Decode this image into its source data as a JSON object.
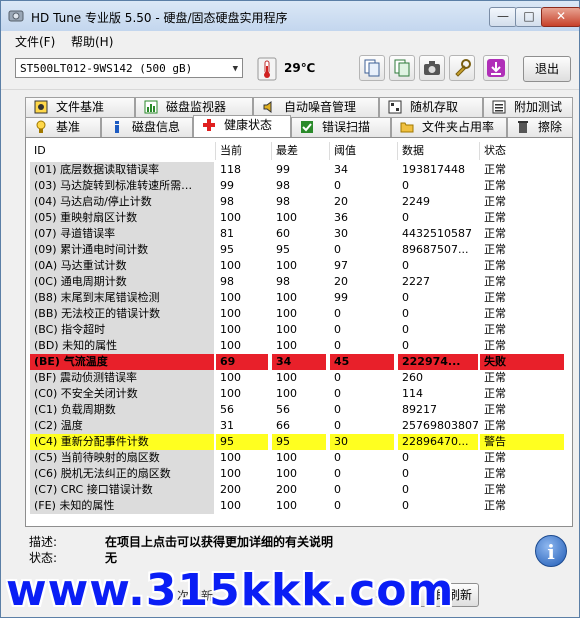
{
  "window": {
    "title": "HD Tune 专业版 5.50 - 硬盘/固态硬盘实用程序"
  },
  "menu": {
    "file": "文件(F)",
    "help": "帮助(H)"
  },
  "toolbar": {
    "drive": "ST500LT012-9WS142 (500 gB)",
    "temperature": "29℃",
    "exit_label": "退出",
    "icons": [
      "copy-info-icon",
      "copy-report-icon",
      "screenshot-camera-icon",
      "options-wrench-icon",
      "save-download-icon"
    ]
  },
  "tabs_top": [
    {
      "label": "文件基准",
      "icon": "file-benchmark-icon"
    },
    {
      "label": "磁盘监视器",
      "icon": "disk-monitor-icon"
    },
    {
      "label": "自动噪音管理",
      "icon": "speaker-icon"
    },
    {
      "label": "随机存取",
      "icon": "random-access-icon"
    },
    {
      "label": "附加测试",
      "icon": "extra-tests-icon"
    }
  ],
  "tabs_bottom": [
    {
      "label": "基准",
      "icon": "benchmark-icon"
    },
    {
      "label": "磁盘信息",
      "icon": "info-icon"
    },
    {
      "label": "健康状态",
      "icon": "health-cross-icon",
      "active": true
    },
    {
      "label": "错误扫描",
      "icon": "error-scan-icon"
    },
    {
      "label": "文件夹占用率",
      "icon": "folder-icon"
    },
    {
      "label": "擦除",
      "icon": "erase-bin-icon"
    }
  ],
  "table": {
    "headers": [
      "ID",
      "当前",
      "最差",
      "阈值",
      "数据",
      "状态"
    ],
    "rows": [
      [
        "(01) 底层数据读取错误率",
        "118",
        "99",
        "34",
        "193817448",
        "正常"
      ],
      [
        "(03) 马达旋转到标准转速所需…",
        "99",
        "98",
        "0",
        "0",
        "正常"
      ],
      [
        "(04) 马达启动/停止计数",
        "98",
        "98",
        "20",
        "2249",
        "正常"
      ],
      [
        "(05) 重映射扇区计数",
        "100",
        "100",
        "36",
        "0",
        "正常"
      ],
      [
        "(07) 寻道错误率",
        "81",
        "60",
        "30",
        "4432510587",
        "正常"
      ],
      [
        "(09) 累计通电时间计数",
        "95",
        "95",
        "0",
        "89687507...",
        "正常"
      ],
      [
        "(0A) 马达重试计数",
        "100",
        "100",
        "97",
        "0",
        "正常"
      ],
      [
        "(0C) 通电周期计数",
        "98",
        "98",
        "20",
        "2227",
        "正常"
      ],
      [
        "(B8) 末尾到末尾错误检测",
        "100",
        "100",
        "99",
        "0",
        "正常"
      ],
      [
        "(BB) 无法校正的错误计数",
        "100",
        "100",
        "0",
        "0",
        "正常"
      ],
      [
        "(BC) 指令超时",
        "100",
        "100",
        "0",
        "0",
        "正常"
      ],
      [
        "(BD) 未知的属性",
        "100",
        "100",
        "0",
        "0",
        "正常"
      ],
      [
        "(BE) 气流温度",
        "69",
        "34",
        "45",
        "222974...",
        "失败"
      ],
      [
        "(BF) 震动侦测错误率",
        "100",
        "100",
        "0",
        "260",
        "正常"
      ],
      [
        "(C0) 不安全关闭计数",
        "100",
        "100",
        "0",
        "114",
        "正常"
      ],
      [
        "(C1) 负载周期数",
        "56",
        "56",
        "0",
        "89217",
        "正常"
      ],
      [
        "(C2) 温度",
        "31",
        "66",
        "0",
        "25769803807",
        "正常"
      ],
      [
        "(C4) 重新分配事件计数",
        "95",
        "95",
        "30",
        "22896470...",
        "警告"
      ],
      [
        "(C5) 当前待映射的扇区数",
        "100",
        "100",
        "0",
        "0",
        "正常"
      ],
      [
        "(C6) 脱机无法纠正的扇区数",
        "100",
        "100",
        "0",
        "0",
        "正常"
      ],
      [
        "(C7) CRC 接口错误计数",
        "200",
        "200",
        "0",
        "0",
        "正常"
      ],
      [
        "(FE) 未知的属性",
        "100",
        "100",
        "0",
        "0",
        "正常"
      ]
    ],
    "row_status": [
      "ok",
      "ok",
      "ok",
      "ok",
      "ok",
      "ok",
      "ok",
      "ok",
      "ok",
      "ok",
      "ok",
      "ok",
      "fail",
      "ok",
      "ok",
      "ok",
      "ok",
      "warn",
      "ok",
      "ok",
      "ok",
      "ok"
    ]
  },
  "description": {
    "desc_label": "描述:",
    "desc_value": "在项目上点击可以获得更加详细的有关说明",
    "status_label": "状态:",
    "status_value": "无"
  },
  "bottom": {
    "partial_left": "健",
    "partial_mid": "次刷新",
    "partial_num": "3",
    "refresh_button": "立即刷新"
  },
  "watermark": "www.315kkk.com",
  "colors": {
    "fail": "#e8202a",
    "warn": "#ffff20",
    "watermark": "#0a1ef5"
  }
}
